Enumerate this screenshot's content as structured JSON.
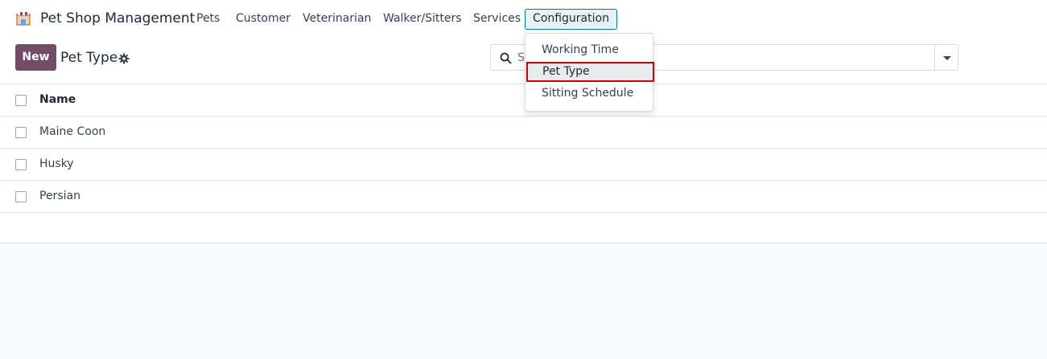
{
  "app": {
    "title": "Pet Shop Management",
    "logo_icon": "pet-shop-logo-icon"
  },
  "nav": {
    "items": [
      {
        "label": "Pets"
      },
      {
        "label": "Customer"
      },
      {
        "label": "Veterinarian"
      },
      {
        "label": "Walker/Sitters"
      },
      {
        "label": "Services"
      },
      {
        "label": "Configuration",
        "active": true
      }
    ]
  },
  "control": {
    "new_label": "New",
    "title": "Pet Type",
    "gear_icon": "gear-icon"
  },
  "search": {
    "placeholder": "Search...",
    "icon": "search-icon",
    "toggle_icon": "caret-down-icon"
  },
  "list": {
    "columns": [
      "Name"
    ],
    "rows": [
      {
        "name": "Maine Coon"
      },
      {
        "name": "Husky"
      },
      {
        "name": "Persian"
      }
    ]
  },
  "dropdown": {
    "items": [
      {
        "label": "Working Time"
      },
      {
        "label": "Pet Type",
        "highlighted": true
      },
      {
        "label": "Sitting Schedule"
      }
    ]
  },
  "colors": {
    "primary": "#714b67",
    "active_border": "#017e84",
    "highlight_border": "#d10000"
  }
}
